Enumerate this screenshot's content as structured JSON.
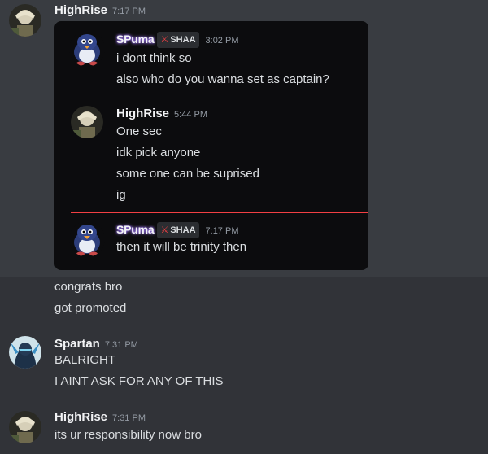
{
  "top_message": {
    "username": "HighRise",
    "time": "7:17 PM"
  },
  "forwarded": {
    "messages": [
      {
        "username": "SPuma",
        "tag": "SHAA",
        "time": "3:02 PM",
        "lines": [
          "i dont think so",
          "also who do you wanna set as captain?"
        ]
      },
      {
        "username": "HighRise",
        "time": "5:44 PM",
        "lines": [
          "One sec",
          "idk pick anyone",
          "some one can be suprised",
          "ig"
        ]
      },
      {
        "username": "SPuma",
        "tag": "SHAA",
        "time": "7:17 PM",
        "lines": [
          "then it will be trinity then"
        ]
      }
    ]
  },
  "continuation": {
    "lines": [
      "congrats bro",
      "got promoted"
    ]
  },
  "spartan_message": {
    "username": "Spartan",
    "time": "7:31 PM",
    "lines": [
      "BALRIGHT",
      "I AINT ASK FOR ANY OF THIS"
    ]
  },
  "bottom_message": {
    "username": "HighRise",
    "time": "7:31 PM",
    "lines": [
      "its ur responsibility now bro"
    ]
  },
  "colors": {
    "background": "#313338",
    "panel": "#0c0c0e",
    "mention_line": "#f23f43",
    "text": "#dbdee1",
    "timestamp": "#949ba4"
  }
}
